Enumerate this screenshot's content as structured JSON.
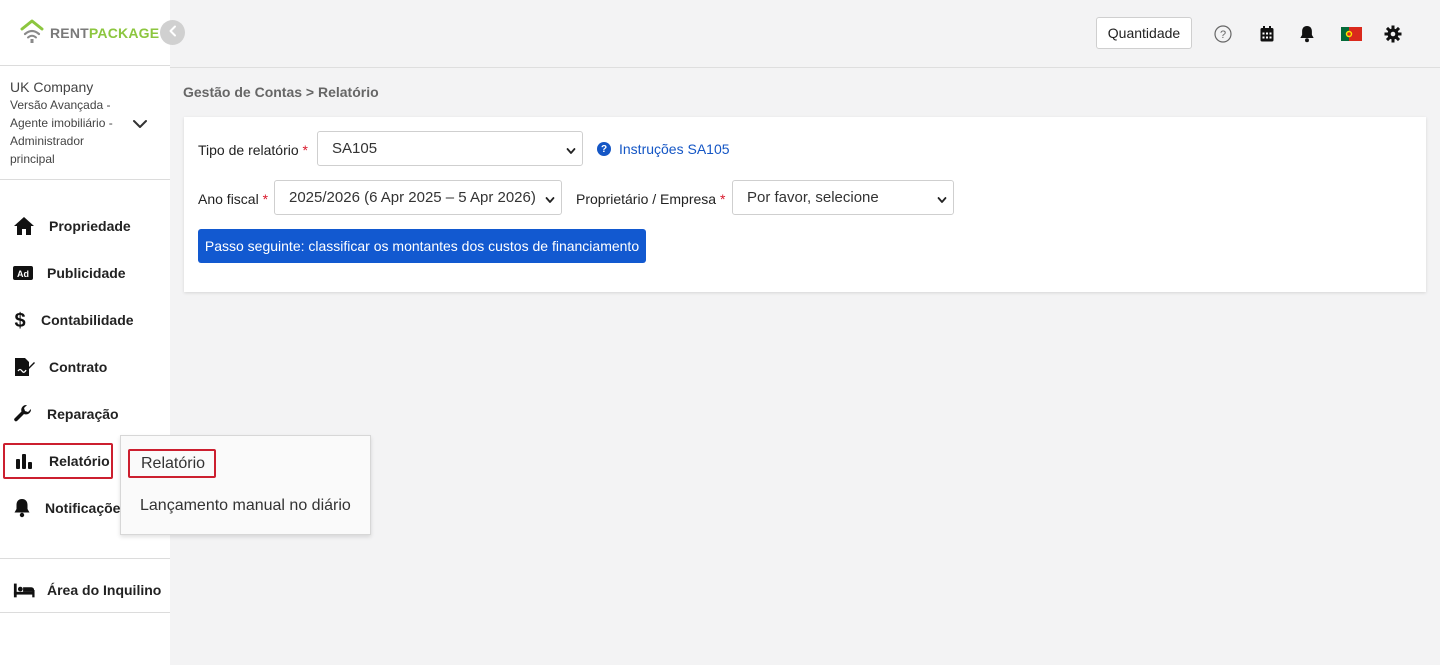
{
  "brand": {
    "rent": "RENT",
    "package": "PACKAGE"
  },
  "account": {
    "company": "UK Company",
    "role_lines": [
      "Versão Avançada -",
      "Agente imobiliário -",
      "Administrador",
      "principal"
    ]
  },
  "sidebar": {
    "items": [
      {
        "label": "Propriedade",
        "icon": "home-icon"
      },
      {
        "label": "Publicidade",
        "icon": "ad-icon"
      },
      {
        "label": "Contabilidade",
        "icon": "dollar-icon"
      },
      {
        "label": "Contrato",
        "icon": "contract-icon"
      },
      {
        "label": "Reparação",
        "icon": "wrench-icon"
      },
      {
        "label": "Relatório",
        "icon": "bar-chart-icon"
      },
      {
        "label": "Notificações",
        "icon": "bell-icon"
      }
    ],
    "tenant_area": "Área do Inquilino"
  },
  "header": {
    "quantity_label": "Quantidade",
    "icons": [
      "help-icon",
      "calendar-icon",
      "bell-icon",
      "portugal-flag-icon",
      "gear-icon"
    ]
  },
  "breadcrumb": "Gestão de Contas > Relatório",
  "form": {
    "report_type_label": "Tipo de relatório",
    "report_type_value": "SA105",
    "instructions_link": "Instruções SA105",
    "fiscal_year_label": "Ano fiscal",
    "fiscal_year_value": "2025/2026 (6 Apr 2025 – 5 Apr 2026)",
    "owner_label": "Proprietário / Empresa",
    "owner_value": "Por favor, selecione",
    "required_mark": "*",
    "next_button": "Passo seguinte: classificar os montantes dos custos de financiamento"
  },
  "submenu": {
    "items": [
      "Relatório",
      "Lançamento manual no diário"
    ]
  },
  "colors": {
    "brand_green": "#8cc63f",
    "primary_blue": "#1259d0",
    "link_blue": "#1456c5",
    "active_outline": "#cc1f2f",
    "required_red": "#d9182b"
  }
}
